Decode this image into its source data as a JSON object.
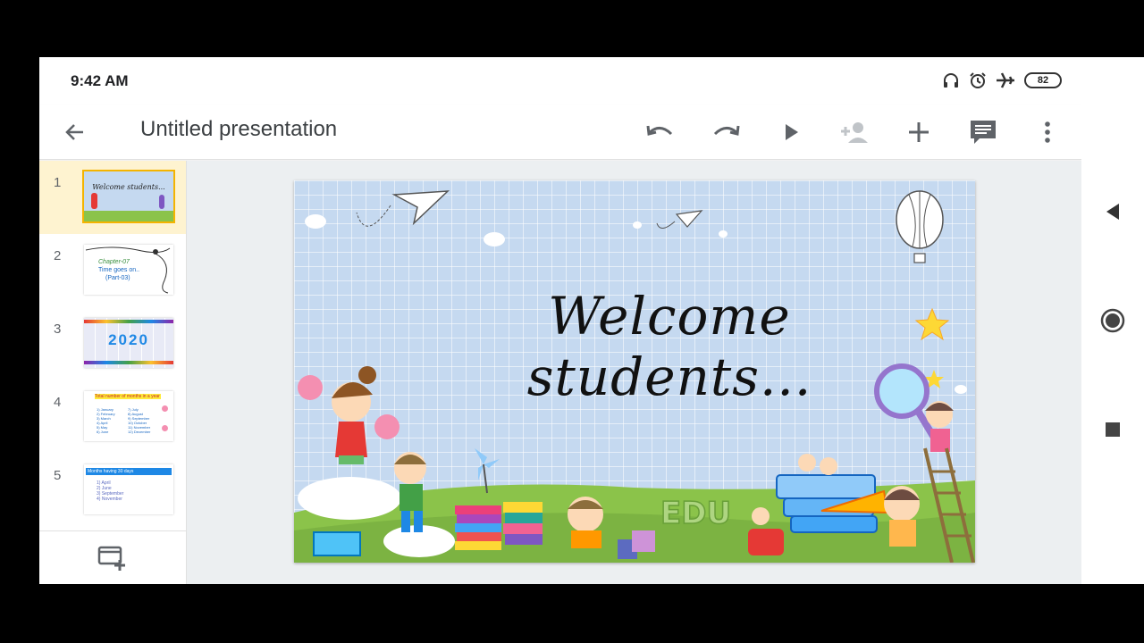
{
  "status": {
    "time": "9:42 AM",
    "battery": "82"
  },
  "toolbar": {
    "title": "Untitled presentation"
  },
  "slides": [
    {
      "number": "1",
      "text": "Welcome students..."
    },
    {
      "number": "2",
      "lines": [
        "Chapter-07",
        "Time goes on..",
        "(Part-03)"
      ]
    },
    {
      "number": "3",
      "text": "2020"
    },
    {
      "number": "4",
      "heading": "Total number of months in a year",
      "items": [
        "1) January",
        "2) February",
        "3) March",
        "4) April",
        "5) May",
        "6) June",
        "7) July",
        "8) August",
        "9) September",
        "10) October",
        "11) November",
        "12) December"
      ]
    },
    {
      "number": "5",
      "heading": "Months having 30 days",
      "items": [
        "1) April",
        "2) June",
        "3) September",
        "4) November"
      ]
    }
  ],
  "main_slide": {
    "title": "Welcome students...",
    "edu_text": "EDU"
  },
  "colors": {
    "selection": "#fef3d0",
    "accent": "#f4b400",
    "slide_bg": "#c5d9f0",
    "grass": "#8bc34a"
  }
}
